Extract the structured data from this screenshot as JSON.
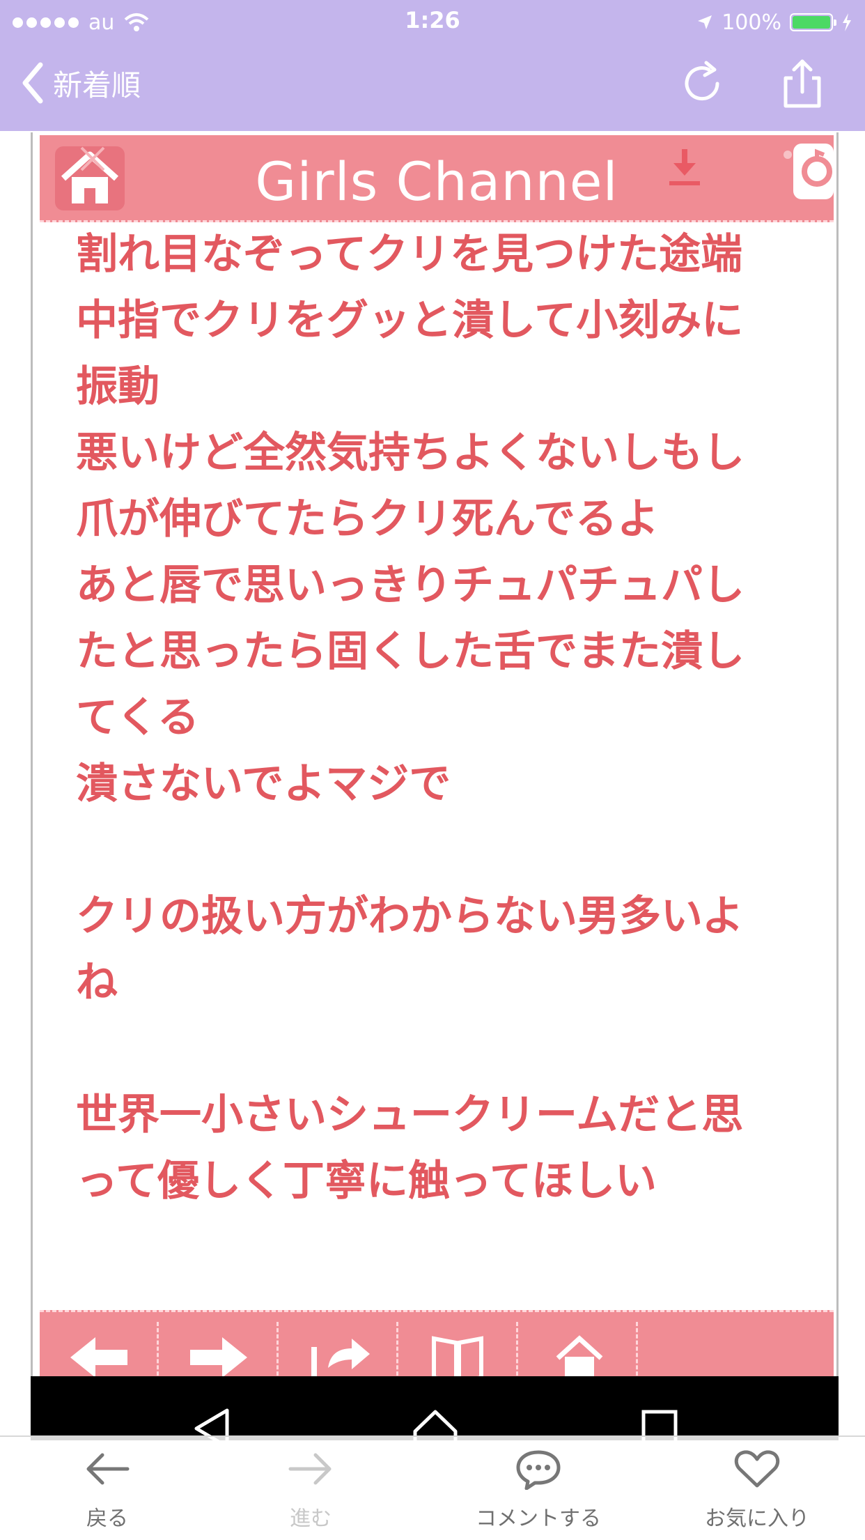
{
  "status_bar": {
    "carrier": "au",
    "time": "1:26",
    "battery": "100%"
  },
  "nav_bar": {
    "back_label": "新着順",
    "reload_icon": "reload-icon",
    "share_icon": "share-icon"
  },
  "page": {
    "site_title": "Girls Channel",
    "post_lines": [
      "割れ目なぞってクリを見つけた途端",
      "中指でクリをグッと潰して小刻みに",
      "振動",
      "悪いけど全然気持ちよくないしもし",
      "爪が伸びてたらクリ死んでるよ",
      "あと唇で思いっきりチュパチュパし",
      "たと思ったら固くした舌でまた潰し",
      "てくる",
      "潰さないでよマジで",
      "",
      "クリの扱い方がわからない男多いよ",
      "ね",
      "",
      "世界一小さいシュークリームだと思",
      "って優しく丁寧に触ってほしい"
    ]
  },
  "toolbar": {
    "back": "戻る",
    "forward": "進む",
    "comment": "コメントする",
    "favorite": "お気に入り"
  },
  "colors": {
    "nav_bg": "#c4b5ec",
    "gc_pink": "#f08c94",
    "text_pink": "#e2585f"
  }
}
